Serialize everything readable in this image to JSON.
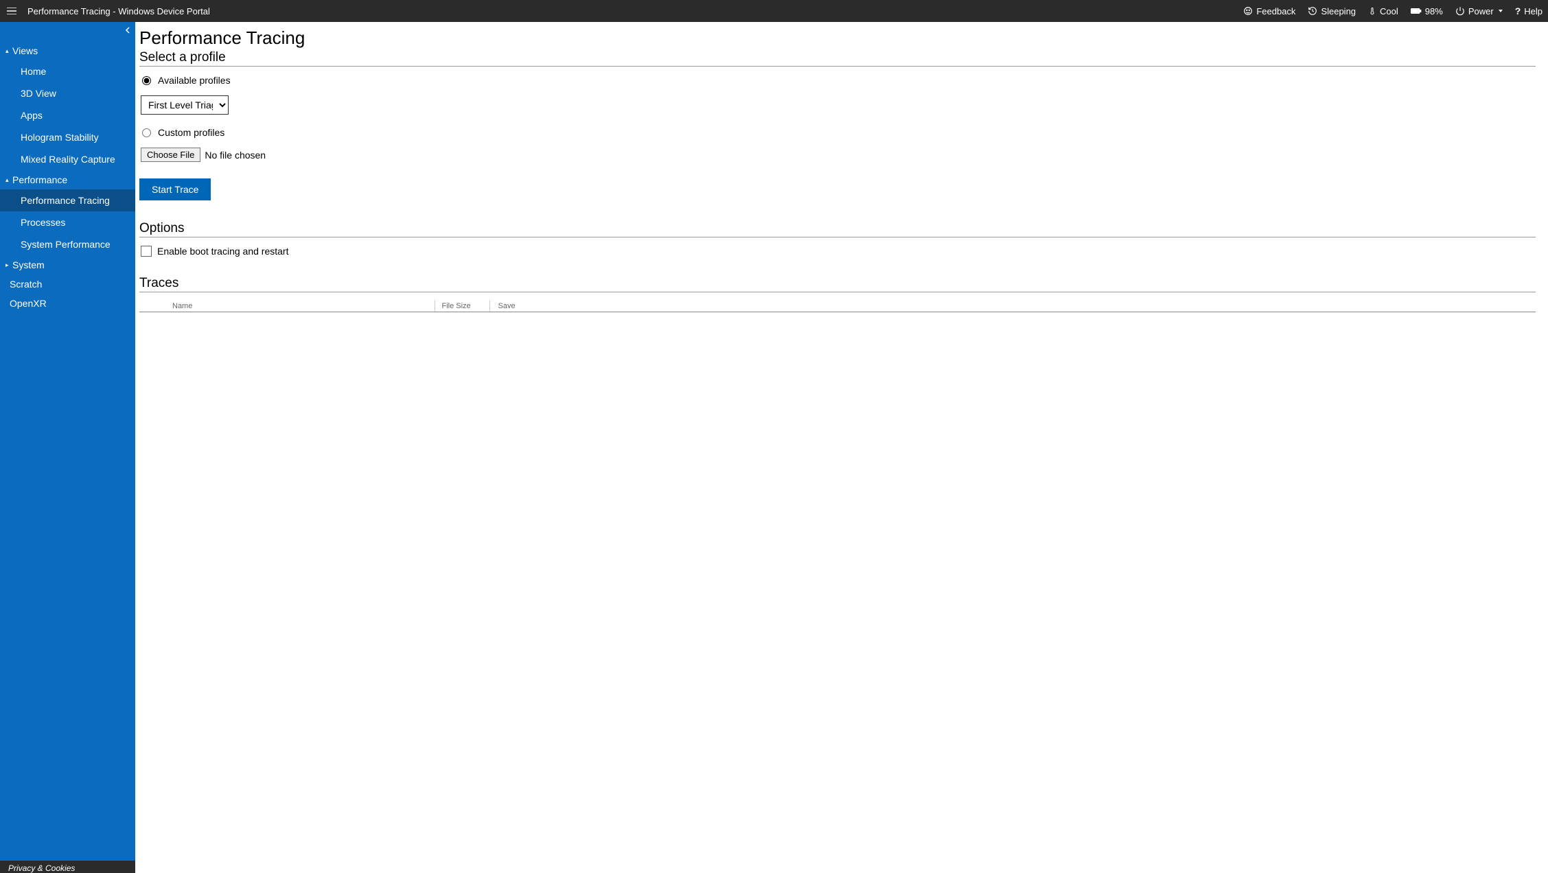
{
  "topbar": {
    "title": "Performance Tracing - Windows Device Portal",
    "feedback": "Feedback",
    "sleeping": "Sleeping",
    "cool": "Cool",
    "battery": "98%",
    "power": "Power",
    "help": "Help"
  },
  "sidebar": {
    "groups": [
      {
        "label": "Views",
        "expanded": true,
        "items": [
          "Home",
          "3D View",
          "Apps",
          "Hologram Stability",
          "Mixed Reality Capture"
        ]
      },
      {
        "label": "Performance",
        "expanded": true,
        "items": [
          "Performance Tracing",
          "Processes",
          "System Performance"
        ],
        "active_index": 0
      },
      {
        "label": "System",
        "expanded": false,
        "items": []
      }
    ],
    "top_items": [
      "Scratch",
      "OpenXR"
    ],
    "footer": "Privacy & Cookies"
  },
  "main": {
    "title": "Performance Tracing",
    "section_profile": "Select a profile",
    "radio_available": "Available profiles",
    "profile_select_value": "First Level Triage",
    "radio_custom": "Custom profiles",
    "choose_file_btn": "Choose File",
    "no_file": "No file chosen",
    "start_trace": "Start Trace",
    "section_options": "Options",
    "checkbox_boot": "Enable boot tracing and restart",
    "section_traces": "Traces",
    "table_headers": {
      "name": "Name",
      "size": "File Size",
      "save": "Save"
    }
  }
}
